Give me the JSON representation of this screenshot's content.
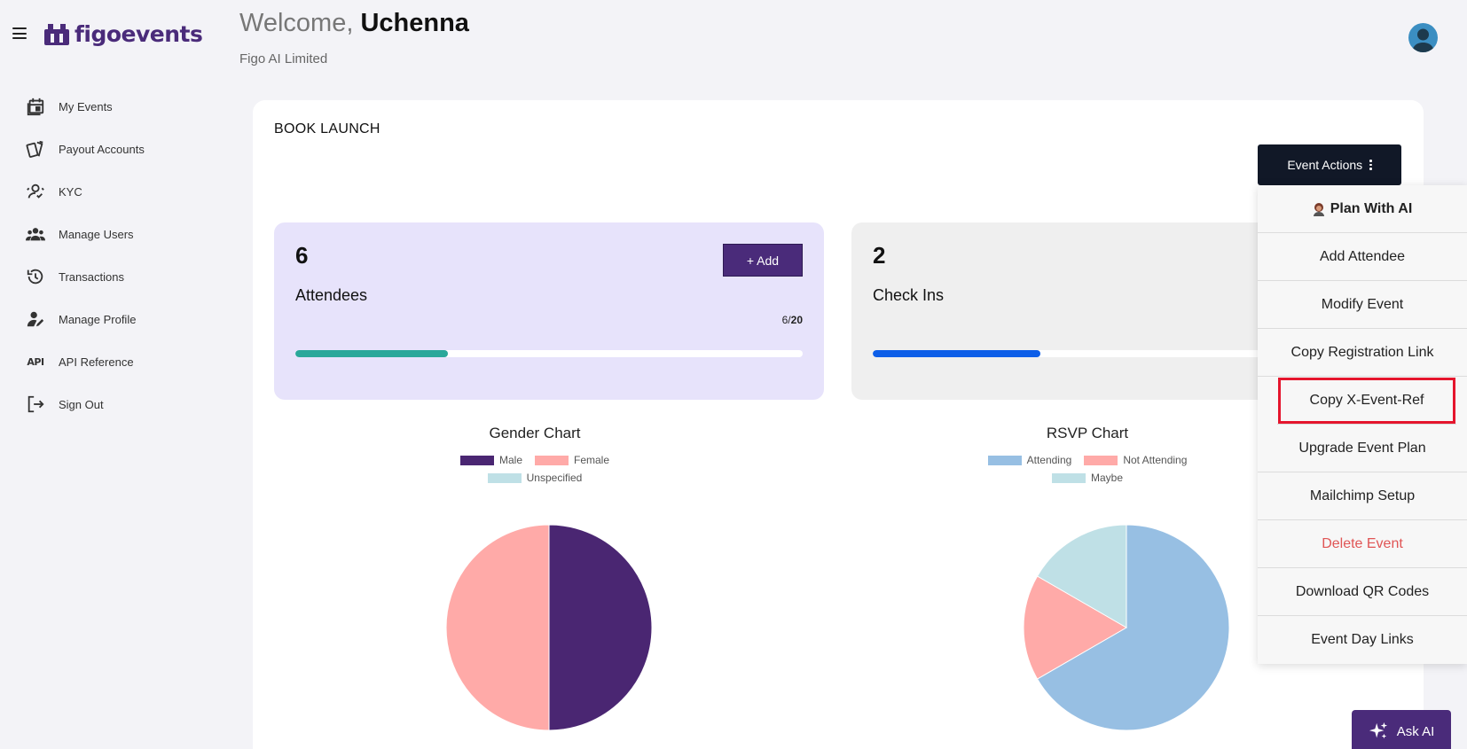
{
  "app": {
    "logo_text": "figoevents"
  },
  "sidebar": {
    "items": [
      {
        "label": "My Events",
        "icon": "calendar-icon"
      },
      {
        "label": "Payout Accounts",
        "icon": "cards-icon"
      },
      {
        "label": "KYC",
        "icon": "user-verify-icon"
      },
      {
        "label": "Manage Users",
        "icon": "users-icon"
      },
      {
        "label": "Transactions",
        "icon": "history-icon"
      },
      {
        "label": "Manage Profile",
        "icon": "user-edit-icon"
      },
      {
        "label": "API Reference",
        "icon": "api-icon",
        "icon_text": "API"
      },
      {
        "label": "Sign Out",
        "icon": "sign-out-icon"
      }
    ]
  },
  "header": {
    "welcome_prefix": "Welcome, ",
    "user_name": "Uchenna",
    "organization": "Figo AI Limited"
  },
  "event": {
    "title": "BOOK LAUNCH",
    "actions_label": "Event Actions"
  },
  "stats": {
    "attendees": {
      "count": "6",
      "label": "Attendees",
      "add_label": "+ Add",
      "ratio_current": "6/",
      "ratio_max": "20",
      "progress": 0.3,
      "bar_color": "#2aa89a"
    },
    "checkins": {
      "count": "2",
      "label": "Check Ins",
      "progress": 0.33,
      "bar_color": "#0d5ee8"
    }
  },
  "charts": {
    "gender": {
      "title": "Gender Chart",
      "legend": [
        {
          "label": "Male",
          "color": "#4a2672"
        },
        {
          "label": "Female",
          "color": "#ffaaa8"
        },
        {
          "label": "Unspecified",
          "color": "#bfe0e6"
        }
      ]
    },
    "rsvp": {
      "title": "RSVP Chart",
      "legend": [
        {
          "label": "Attending",
          "color": "#97bfe3"
        },
        {
          "label": "Not Attending",
          "color": "#ffaaa8"
        },
        {
          "label": "Maybe",
          "color": "#bfe0e6"
        }
      ]
    }
  },
  "chart_data": [
    {
      "type": "pie",
      "title": "Gender Chart",
      "categories": [
        "Male",
        "Female",
        "Unspecified"
      ],
      "values": [
        3,
        3,
        0
      ],
      "colors": [
        "#4a2672",
        "#ffaaa8",
        "#bfe0e6"
      ],
      "legend": "top"
    },
    {
      "type": "pie",
      "title": "RSVP Chart",
      "categories": [
        "Attending",
        "Not Attending",
        "Maybe"
      ],
      "values": [
        4,
        1,
        1
      ],
      "colors": [
        "#97bfe3",
        "#ffaaa8",
        "#bfe0e6"
      ],
      "legend": "top"
    }
  ],
  "menu": {
    "items": [
      {
        "label": "Plan With AI",
        "style": "bold",
        "icon": "avatar-icon"
      },
      {
        "label": "Add Attendee",
        "style": ""
      },
      {
        "label": "Modify Event",
        "style": ""
      },
      {
        "label": "Copy Registration Link",
        "style": ""
      },
      {
        "label": "Copy X-Event-Ref",
        "style": "highlight"
      },
      {
        "label": "Upgrade Event Plan",
        "style": ""
      },
      {
        "label": "Mailchimp Setup",
        "style": ""
      },
      {
        "label": "Delete Event",
        "style": "danger"
      },
      {
        "label": "Download QR Codes",
        "style": ""
      },
      {
        "label": "Event Day Links",
        "style": ""
      }
    ]
  },
  "ask_ai": {
    "label": "Ask AI",
    "icon": "sparkle-icon"
  }
}
